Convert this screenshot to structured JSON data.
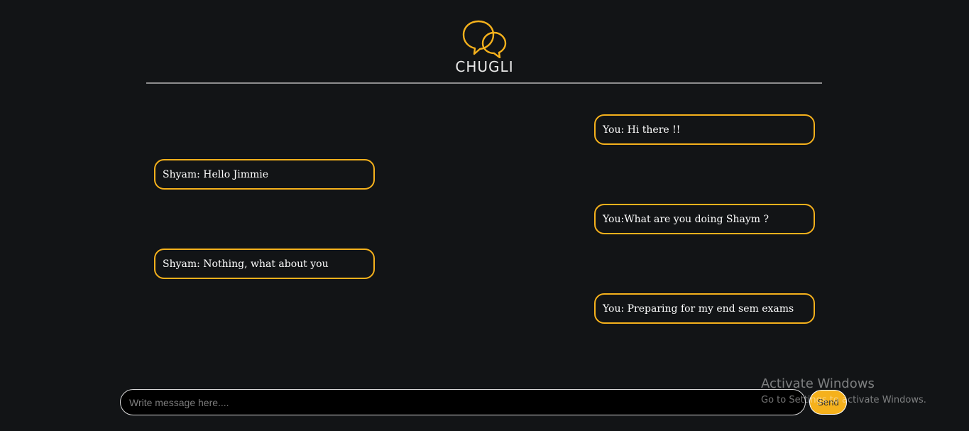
{
  "app": {
    "brand": "CHUGLI",
    "logo_icon": "chat-bubbles-icon",
    "accent_color": "#f5b11c",
    "background_color": "#121416"
  },
  "messages": [
    {
      "side": "right",
      "text": "You: Hi there !!"
    },
    {
      "side": "left",
      "text": "Shyam: Hello Jimmie"
    },
    {
      "side": "right",
      "text": "You:What are you doing Shaym ?"
    },
    {
      "side": "left",
      "text": "Shyam: Nothing, what about you"
    },
    {
      "side": "right",
      "text": "You: Preparing for my end sem exams"
    }
  ],
  "composer": {
    "placeholder": "Write message here....",
    "value": "",
    "send_label": "Send"
  },
  "watermark": {
    "title": "Activate Windows",
    "subtitle": "Go to Settings to activate Windows."
  }
}
